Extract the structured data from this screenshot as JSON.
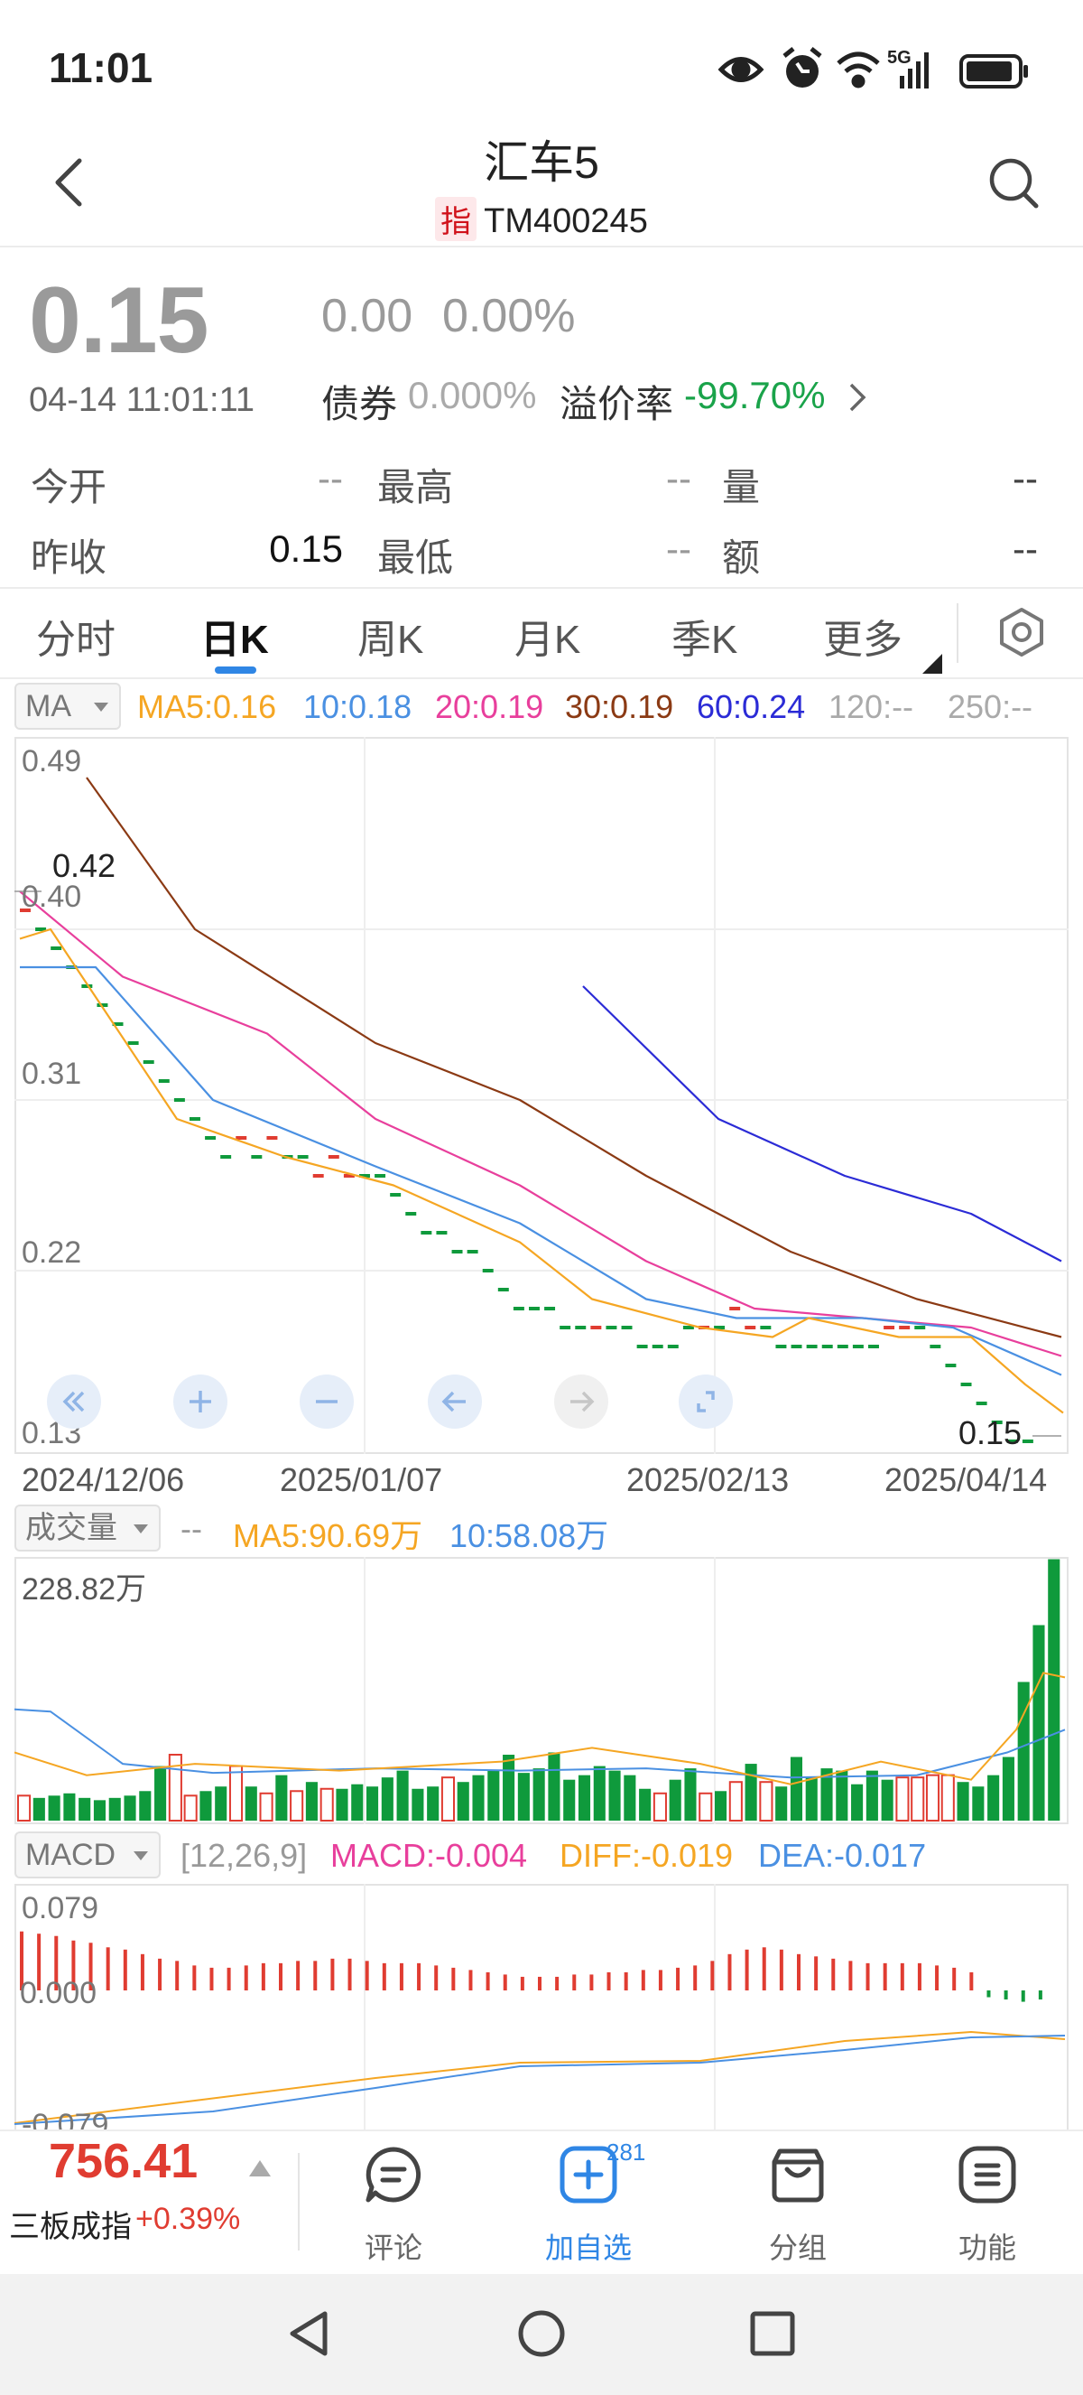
{
  "status_bar": {
    "time": "11:01",
    "icons": [
      "eye-icon",
      "alarm-icon",
      "wifi-icon",
      "5g-signal-icon",
      "battery-icon"
    ],
    "network": "5G"
  },
  "header": {
    "title": "汇车5",
    "badge": "指",
    "code": "TM400245"
  },
  "quote": {
    "price": "0.15",
    "change": "0.00",
    "change_pct": "0.00%",
    "timestamp": "04-14 11:01:11",
    "bond_label": "债券",
    "bond_value": "0.000%",
    "premium_label": "溢价率",
    "premium_value": "-99.70%"
  },
  "stats": {
    "open_label": "今开",
    "open_value": "--",
    "high_label": "最高",
    "high_value": "--",
    "vol_label": "量",
    "vol_value": "--",
    "prev_label": "昨收",
    "prev_value": "0.15",
    "low_label": "最低",
    "low_value": "--",
    "amt_label": "额",
    "amt_value": "--"
  },
  "tabs": [
    "分时",
    "日K",
    "周K",
    "月K",
    "季K",
    "更多"
  ],
  "active_tab": "日K",
  "ma_bar": {
    "selector": "MA",
    "ma5": "MA5:0.16",
    "ma10": "10:0.18",
    "ma20": "20:0.19",
    "ma30": "30:0.19",
    "ma60": "60:0.24",
    "ma120": "120:--",
    "ma250": "250:--"
  },
  "kline": {
    "y_labels": [
      "0.49",
      "0.40",
      "0.31",
      "0.22",
      "0.13"
    ],
    "high_marker": "0.42",
    "last_marker": "0.15",
    "dates": [
      "2024/12/06",
      "2025/01/07",
      "2025/02/13",
      "2025/04/14"
    ]
  },
  "volume_bar": {
    "selector": "成交量",
    "dash": "--",
    "ma5": "MA5:90.69万",
    "ma10": "10:58.08万",
    "max_label": "228.82万"
  },
  "macd_bar": {
    "selector": "MACD",
    "params": "[12,26,9]",
    "macd": "MACD:-0.004",
    "diff": "DIFF:-0.019",
    "dea": "DEA:-0.017",
    "y_top": "0.079",
    "y_mid": "0.000",
    "y_bottom": "-0.079"
  },
  "colors": {
    "up": "#e03c31",
    "down": "#0f9a3c",
    "ma5": "#f5a623",
    "ma10": "#4a90e2",
    "ma20": "#e83f9c",
    "ma30": "#8b3a14",
    "ma60": "#2b2bd6",
    "accent": "#2f86e5"
  },
  "bottom": {
    "index_value": "756.41",
    "index_name": "三板成指",
    "index_change": "+0.39%",
    "items": [
      {
        "label": "评论",
        "icon": "comment-icon"
      },
      {
        "label": "加自选",
        "icon": "add-favorite-icon",
        "badge": "281"
      },
      {
        "label": "分组",
        "icon": "group-icon"
      },
      {
        "label": "功能",
        "icon": "menu-icon"
      }
    ]
  },
  "chart_data": [
    {
      "type": "line",
      "title": "",
      "x": [
        "2024/12/06",
        "2025/01/07",
        "2025/02/13",
        "2025/04/14"
      ],
      "ylim": [
        0.13,
        0.49
      ],
      "series": [
        {
          "name": "MA5",
          "values": [
            0.39,
            0.26,
            0.19,
            0.16
          ]
        },
        {
          "name": "10",
          "values": [
            0.38,
            0.27,
            0.19,
            0.18
          ]
        },
        {
          "name": "20",
          "values": [
            0.42,
            0.3,
            0.21,
            0.19
          ]
        },
        {
          "name": "30",
          "values": [
            0.46,
            0.34,
            0.22,
            0.19
          ]
        },
        {
          "name": "60",
          "values": [
            null,
            null,
            0.35,
            0.24
          ]
        }
      ]
    },
    {
      "type": "bar",
      "title": "成交量",
      "ylim": [
        0,
        228.82
      ],
      "values": [
        22,
        20,
        22,
        24,
        20,
        18,
        20,
        22,
        26,
        48,
        58,
        22,
        26,
        30,
        48,
        30,
        24,
        40,
        26,
        34,
        28,
        28,
        32,
        30,
        38,
        44,
        28,
        30,
        38,
        34,
        40,
        44,
        58,
        42,
        46,
        60,
        36,
        40,
        48,
        44,
        40,
        28,
        24,
        36,
        46,
        24,
        26,
        34,
        50,
        34,
        30,
        56,
        38,
        46,
        44,
        32,
        44,
        36,
        38,
        38,
        40,
        40,
        34,
        30,
        40,
        56,
        122,
        172,
        230
      ]
    },
    {
      "type": "bar",
      "title": "MACD",
      "ylim": [
        -0.079,
        0.079
      ],
      "values": [
        0.026,
        0.025,
        0.024,
        0.022,
        0.021,
        0.019,
        0.018,
        0.016,
        0.014,
        0.013,
        0.011,
        0.01,
        0.01,
        0.011,
        0.012,
        0.012,
        0.013,
        0.013,
        0.014,
        0.014,
        0.013,
        0.012,
        0.012,
        0.012,
        0.011,
        0.01,
        0.009,
        0.008,
        0.007,
        0.006,
        0.006,
        0.006,
        0.007,
        0.007,
        0.008,
        0.008,
        0.009,
        0.009,
        0.01,
        0.011,
        0.013,
        0.016,
        0.018,
        0.019,
        0.018,
        0.016,
        0.015,
        0.014,
        0.013,
        0.012,
        0.012,
        0.012,
        0.012,
        0.011,
        0.01,
        0.008,
        -0.003,
        -0.004,
        -0.005,
        -0.004
      ]
    }
  ]
}
